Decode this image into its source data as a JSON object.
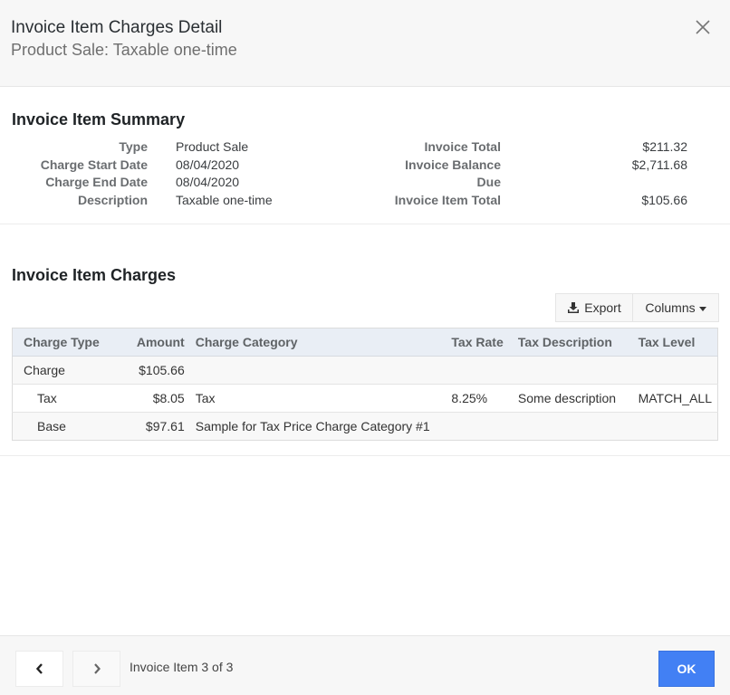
{
  "header": {
    "title": "Invoice Item Charges Detail",
    "subtitle": "Product Sale: Taxable one-time",
    "close_icon": "close-icon"
  },
  "summary": {
    "title": "Invoice Item Summary",
    "left": [
      {
        "label": "Type",
        "value": "Product Sale"
      },
      {
        "label": "Charge Start Date",
        "value": "08/04/2020"
      },
      {
        "label": "Charge End Date",
        "value": "08/04/2020"
      },
      {
        "label": "Description",
        "value": "Taxable one-time"
      }
    ],
    "right": [
      {
        "label": "Invoice Total",
        "value": "$211.32"
      },
      {
        "label": "Invoice Balance",
        "value": "$2,711.68"
      },
      {
        "label": "Due",
        "value": ""
      },
      {
        "label": "Invoice Item Total",
        "value": "$105.66"
      }
    ]
  },
  "charges": {
    "title": "Invoice Item Charges",
    "export_label": "Export",
    "export_icon": "download-icon",
    "columns_label": "Columns",
    "columns": [
      "Charge Type",
      "Amount",
      "Charge Category",
      "Tax Rate",
      "Tax Description",
      "Tax Level"
    ],
    "rows": [
      {
        "type": "Charge",
        "amount": "$105.66",
        "category": "",
        "tax_rate": "",
        "tax_description": "",
        "tax_level": ""
      },
      {
        "type": "Tax",
        "amount": "$8.05",
        "category": "Tax",
        "tax_rate": "8.25%",
        "tax_description": "Some description",
        "tax_level": "MATCH_ALL"
      },
      {
        "type": "Base",
        "amount": "$97.61",
        "category": "Sample for Tax Price Charge Category #1",
        "tax_rate": "",
        "tax_description": "",
        "tax_level": ""
      }
    ]
  },
  "footer": {
    "prev_icon": "chevron-left-icon",
    "next_icon": "chevron-right-icon",
    "pager_text": "Invoice Item 3 of 3",
    "ok_label": "OK"
  },
  "colors": {
    "primary": "#4280f4",
    "header_bg": "#f7f7f7",
    "table_header_bg": "#e9eef5"
  }
}
